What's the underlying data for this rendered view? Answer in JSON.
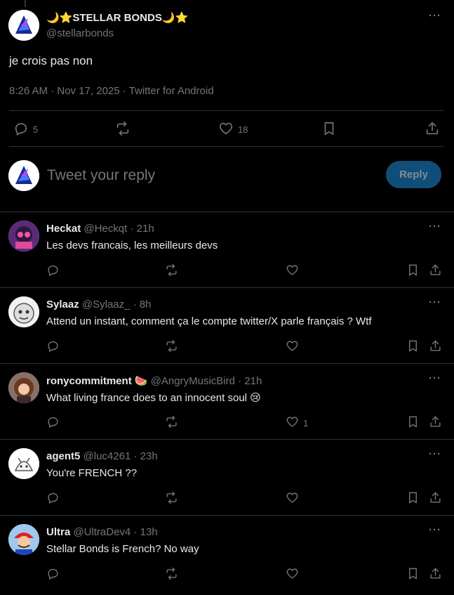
{
  "main": {
    "display_name": "🌙⭐STELLAR BONDS🌙⭐",
    "handle": "@stellarbonds",
    "more": "···",
    "text": "je crois pas non",
    "meta": "8:26 AM · Nov 17, 2025 · Twitter for Android",
    "replies_count": "5",
    "likes_count": "18"
  },
  "compose": {
    "placeholder": "Tweet your reply",
    "button_label": "Reply"
  },
  "replies": [
    {
      "name": "Heckat",
      "handle": "@Heckqt",
      "time": "· 21h",
      "text": "Les devs francais, les meilleurs devs",
      "likes": ""
    },
    {
      "name": "Sylaaz",
      "handle": "@Sylaaz_",
      "time": "· 8h",
      "text": "Attend un instant, comment ça le compte twitter/X parle français ? Wtf",
      "likes": ""
    },
    {
      "name": "ronycommitment 🍉",
      "handle": "@AngryMusicBird",
      "time": "· 21h",
      "text": "What living france does to an innocent soul 😢",
      "likes": "1"
    },
    {
      "name": "agent5",
      "handle": "@luc4261",
      "time": "· 23h",
      "text": "You're FRENCH ??",
      "likes": ""
    },
    {
      "name": "Ultra",
      "handle": "@UltraDev4",
      "time": "· 13h",
      "text": "Stellar Bonds is French? No way",
      "likes": ""
    }
  ],
  "more": "···",
  "colors": {
    "accent": "#1d9bf0",
    "muted": "#71767b",
    "border": "#2f3336",
    "button": "#0f4e78"
  }
}
